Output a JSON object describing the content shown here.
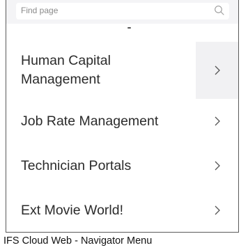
{
  "search": {
    "placeholder": "Find page",
    "icon": "search-icon"
  },
  "menu": {
    "items": [
      {
        "label": "Human Capital Management",
        "icon": "chevron-right-icon"
      },
      {
        "label": "Job Rate Management",
        "icon": "chevron-right-icon"
      },
      {
        "label": "Technician Portals",
        "icon": "chevron-right-icon"
      },
      {
        "label": "Ext Movie World!",
        "icon": "chevron-right-icon"
      }
    ]
  },
  "caption": "IFS Cloud Web - Navigator Menu",
  "colors": {
    "search_bar_bg": "#f4f4f6",
    "hover_bg": "#f1f1f3",
    "text": "#2b2b2b",
    "border": "#5a5a5a"
  }
}
